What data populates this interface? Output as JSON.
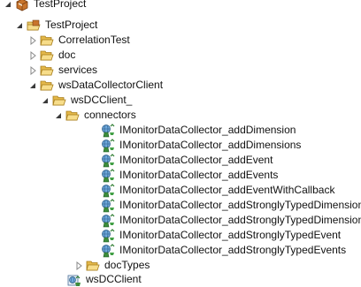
{
  "tree": {
    "root": {
      "label": "TestProject",
      "icon": "project-box-icon",
      "expanded": true
    },
    "project": {
      "label": "TestProject",
      "icon": "package-folder-icon",
      "expanded": true
    },
    "folders": [
      {
        "label": "CorrelationTest",
        "icon": "folder-icon",
        "expanded": false
      },
      {
        "label": "doc",
        "icon": "folder-icon",
        "expanded": false
      },
      {
        "label": "services",
        "icon": "folder-icon",
        "expanded": false
      }
    ],
    "wsDataCollectorClient": {
      "label": "wsDataCollectorClient",
      "icon": "folder-icon",
      "expanded": true
    },
    "wsDCClient_": {
      "label": "wsDCClient_",
      "icon": "folder-icon",
      "expanded": true
    },
    "connectors": {
      "label": "connectors",
      "icon": "folder-icon",
      "expanded": true
    },
    "connector_items": [
      "IMonitorDataCollector_addDimension",
      "IMonitorDataCollector_addDimensions",
      "IMonitorDataCollector_addEvent",
      "IMonitorDataCollector_addEvents",
      "IMonitorDataCollector_addEventWithCallback",
      "IMonitorDataCollector_addStronglyTypedDimension",
      "IMonitorDataCollector_addStronglyTypedDimensions",
      "IMonitorDataCollector_addStronglyTypedEvent",
      "IMonitorDataCollector_addStronglyTypedEvents"
    ],
    "connector_icon": "web-service-connector-icon",
    "docTypes": {
      "label": "docTypes",
      "icon": "folder-icon",
      "expanded": false
    },
    "wsDCClient": {
      "label": "wsDCClient",
      "icon": "web-service-descriptor-icon"
    }
  }
}
